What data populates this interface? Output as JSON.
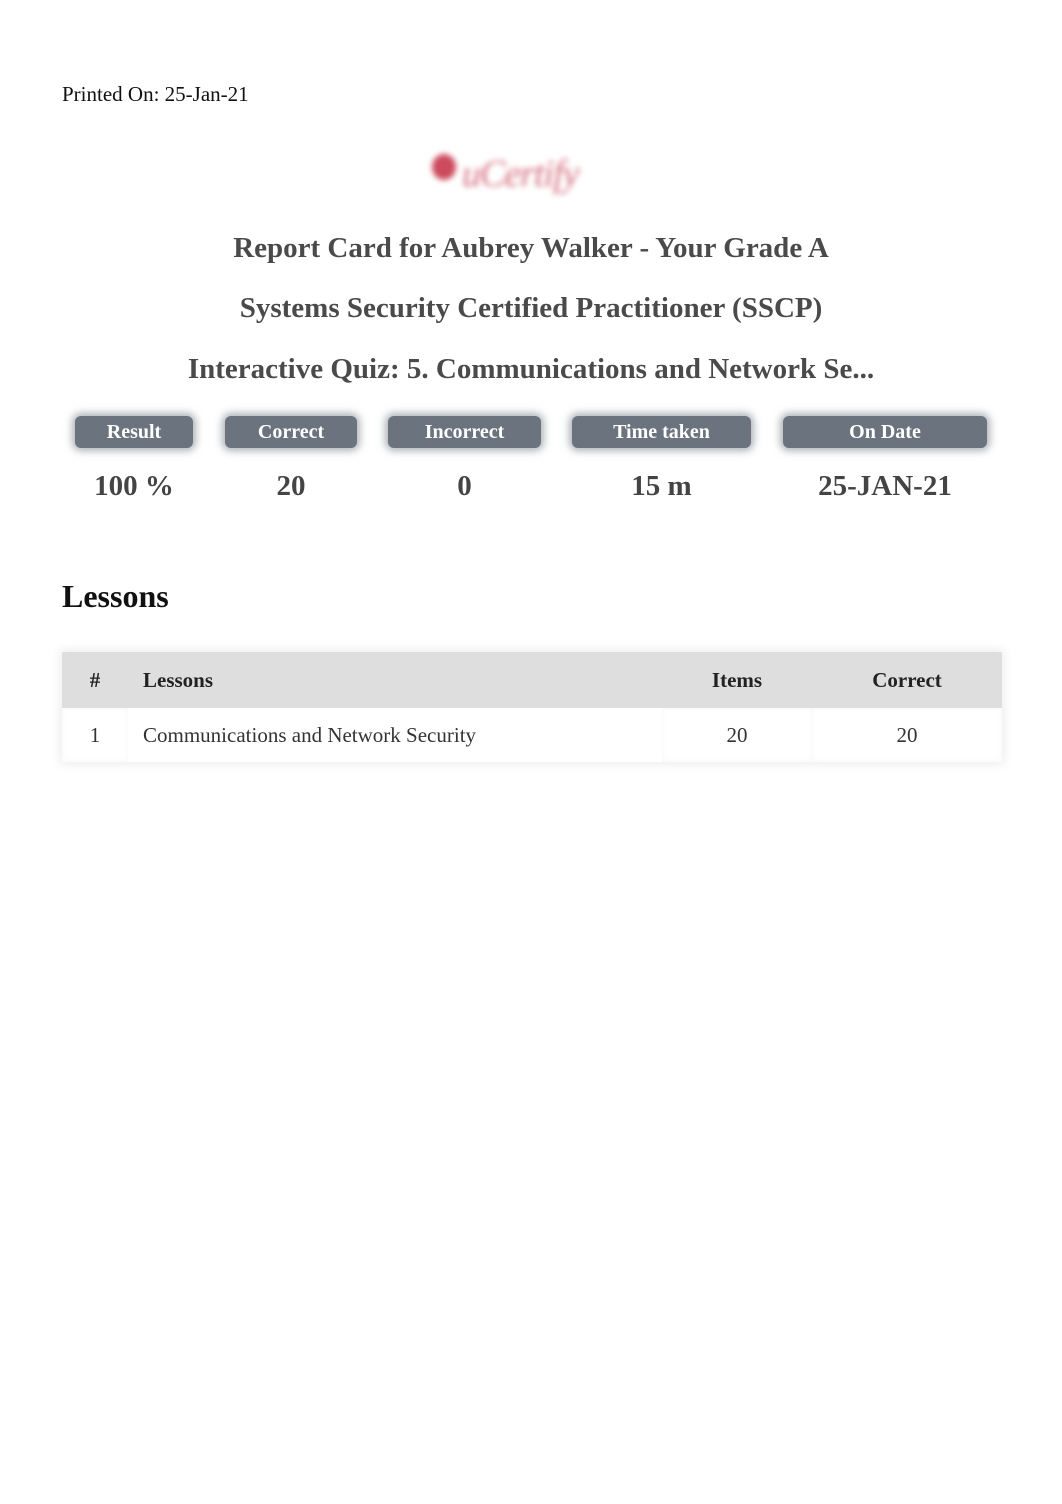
{
  "header": {
    "printed_on": "Printed On: 25-Jan-21",
    "logo_text": "uCertify"
  },
  "titles": {
    "report_card": "Report Card for Aubrey Walker - Your Grade A",
    "course": "Systems Security Certified Practitioner (SSCP)",
    "quiz": "Interactive Quiz: 5. Communications and Network Se..."
  },
  "stats": [
    {
      "label": "Result",
      "value": "100 %"
    },
    {
      "label": "Correct",
      "value": "20"
    },
    {
      "label": "Incorrect",
      "value": "0"
    },
    {
      "label": "Time taken",
      "value": "15 m"
    },
    {
      "label": "On Date",
      "value": "25-JAN-21"
    }
  ],
  "lessons": {
    "heading": "Lessons",
    "columns": [
      "#",
      "Lessons",
      "Items",
      "Correct"
    ],
    "rows": [
      {
        "num": "1",
        "lesson": "Communications and Network Security",
        "items": "20",
        "correct": "20"
      }
    ]
  },
  "colors": {
    "pill_bg": "#6b747e",
    "header_row_bg": "#dedede",
    "logo_red": "#cc4b5d"
  }
}
